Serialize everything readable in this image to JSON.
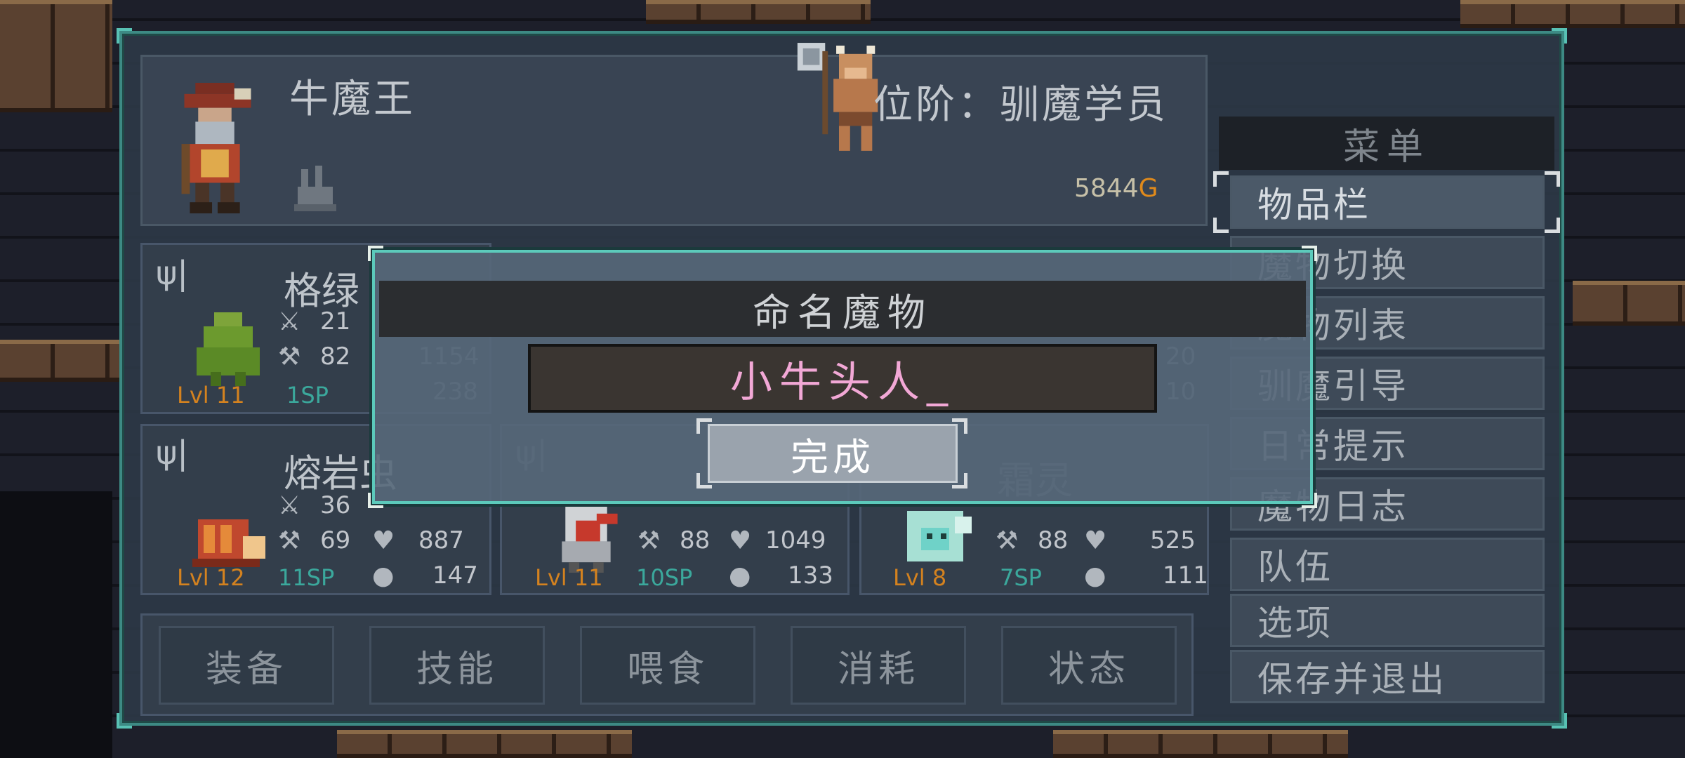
{
  "player": {
    "name": "牛魔王",
    "rank": "位阶：驯魔学员",
    "gold_amount": "5844",
    "gold_unit": "G"
  },
  "monsters": [
    {
      "name": "格绿",
      "attack": "21",
      "defense": "82",
      "hp": "1154",
      "mana": "238",
      "level": "Lvl 11",
      "sp": "1SP"
    },
    {
      "name": "熔岩虫",
      "attack": "36",
      "defense": "69",
      "hp": "887",
      "mana": "147",
      "level": "Lvl 12",
      "sp": "11SP"
    },
    {
      "name": "",
      "attack": "",
      "defense": "88",
      "hp": "1049",
      "mana": "133",
      "level": "Lvl 11",
      "sp": "10SP"
    },
    {
      "name": "霜灵",
      "attack": "",
      "defense": "88",
      "hp": "525",
      "mana": "111",
      "level": "Lvl 8",
      "sp": "7SP",
      "extra_top": "20",
      "extra_mid": "10"
    }
  ],
  "actions": [
    "装备",
    "技能",
    "喂食",
    "消耗",
    "状态"
  ],
  "menu": {
    "title": "菜单",
    "items": [
      "物品栏",
      "魔物切换",
      "魔物列表",
      "驯魔引导",
      "日常提示",
      "魔物日志",
      "队伍",
      "选项",
      "保存并退出"
    ]
  },
  "dialog": {
    "title": "命名魔物",
    "input_value": "小牛头人_",
    "done_label": "完成"
  },
  "colors": {
    "accent_border": "#5ccabb",
    "gold": "#e08a1b",
    "level": "#d4821f",
    "sp": "#3ba89c",
    "input_text": "#f2a8d6"
  }
}
